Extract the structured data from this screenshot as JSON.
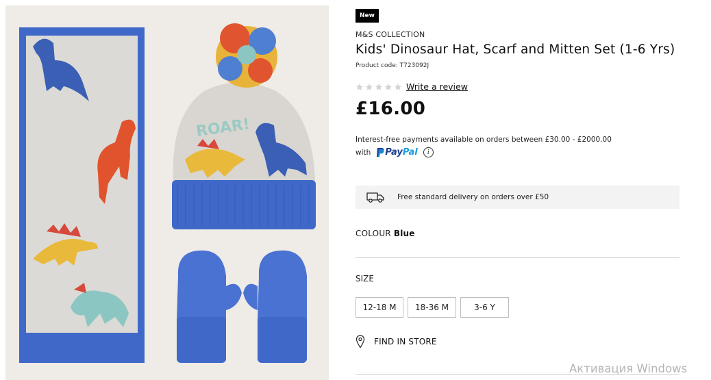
{
  "product_image": {
    "alt_icon": "product-photo"
  },
  "badge": "New",
  "brand": "M&S COLLECTION",
  "title": "Kids' Dinosaur Hat, Scarf and Mitten Set (1-6 Yrs)",
  "product_code": "Product code: T723092J",
  "rating": {
    "stars": 0,
    "max_stars": 5,
    "write_review": "Write a review"
  },
  "price": "£16.00",
  "installments": {
    "text": "Interest-free payments available on orders between £30.00 - £2000.00",
    "with": "with",
    "provider_a": "Pay",
    "provider_b": "Pal",
    "info_icon": "i"
  },
  "delivery": {
    "icon": "truck-icon",
    "text": "Free standard delivery on orders over £50"
  },
  "colour": {
    "label": "COLOUR",
    "value": "Blue"
  },
  "size": {
    "label": "SIZE",
    "options": [
      "12-18 M",
      "18-36 M",
      "3-6 Y"
    ]
  },
  "find_in_store": "FIND IN STORE",
  "watermark": "Активация Windows",
  "colors": {
    "blue": "#3f68c9",
    "paypal_dark": "#1a3d8f",
    "paypal_light": "#1e9be0",
    "badge_bg": "#000000"
  }
}
